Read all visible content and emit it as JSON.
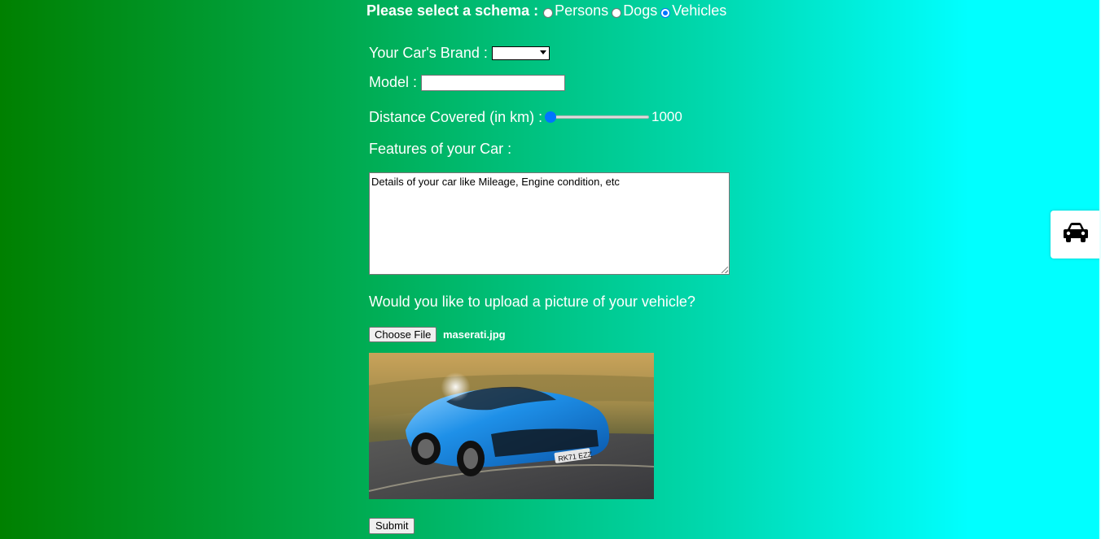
{
  "schema": {
    "prompt": "Please select a schema :",
    "options": [
      {
        "label": "Persons",
        "checked": false
      },
      {
        "label": "Dogs",
        "checked": false
      },
      {
        "label": "Vehicles",
        "checked": true
      }
    ]
  },
  "form": {
    "brand_label": "Your Car's Brand :",
    "brand_value": "",
    "model_label": "Model :",
    "model_value": "",
    "distance_label": "Distance Covered (in km) :",
    "distance_value": "1000",
    "distance_fraction": 0.0,
    "features_label": "Features of your Car :",
    "features_placeholder": "Details of your car like Mileage, Engine condition, etc",
    "upload_question": "Would you like to upload a picture of your vehicle?",
    "choose_file_label": "Choose File",
    "file_name": "maserati.jpg",
    "plate_text": "RK71 EZZ",
    "submit_label": "Submit"
  },
  "side_tab": {
    "icon": "car-icon"
  },
  "colors": {
    "gradient_start": "#008000",
    "gradient_end": "#00ffff",
    "accent": "#0075ff",
    "car_body": "#1e90e8"
  }
}
